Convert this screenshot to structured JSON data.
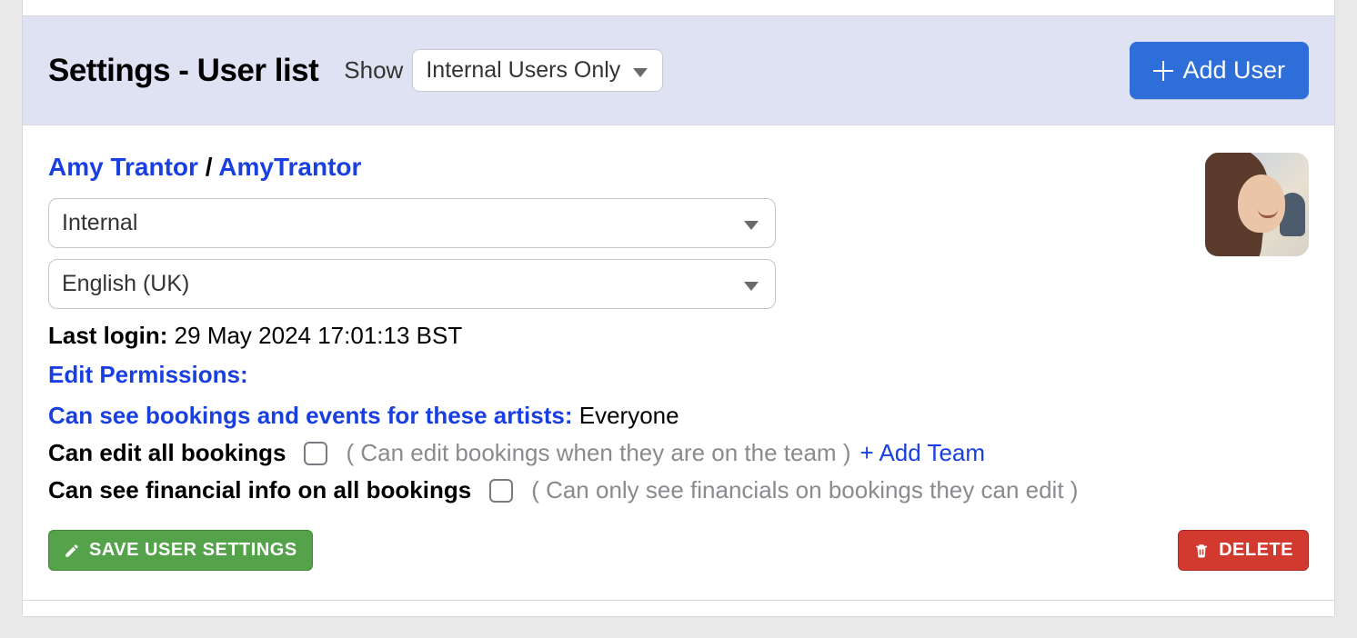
{
  "header": {
    "title": "Settings - User list",
    "show_label": "Show",
    "filter_selected": "Internal Users Only",
    "add_user_label": "Add User"
  },
  "user": {
    "display_name": "Amy Trantor",
    "username": "AmyTrantor",
    "type_selected": "Internal",
    "language_selected": "English (UK)",
    "last_login_label": "Last login",
    "last_login_value": "29 May 2024 17:01:13 BST",
    "edit_permissions_label": "Edit Permissions:",
    "see_bookings_label": "Can see bookings and events for these artists:",
    "see_bookings_value": "Everyone",
    "edit_all_label": "Can edit all bookings",
    "edit_all_hint": "( Can edit bookings when they are on the team )",
    "add_team_label": "+ Add Team",
    "see_financial_label": "Can see financial info on all bookings",
    "see_financial_hint": "( Can only see financials on bookings they can edit )"
  },
  "actions": {
    "save_label": "SAVE USER SETTINGS",
    "delete_label": "DELETE"
  }
}
